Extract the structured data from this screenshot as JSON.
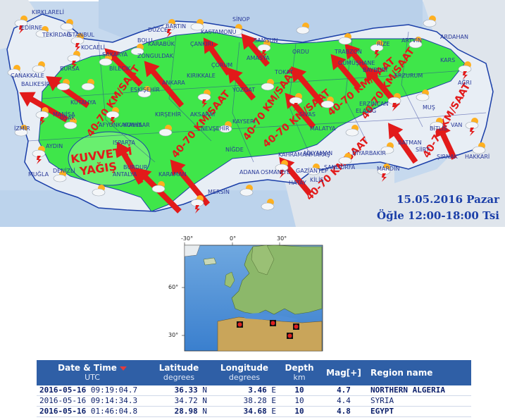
{
  "forecast": {
    "date": "15.05.2016 Pazar",
    "time": "Öğle 12:00-18:00 Tsi",
    "wind_label": "40-70 KM/SAAT",
    "rain_label_1": "KUVVETLİ",
    "rain_label_2": "YAĞIŞ",
    "colors": {
      "rain_zone": "#3fe64a",
      "land": "#e8eef5",
      "sea": "#c6d9ee",
      "arrow": "#e21a1a",
      "label_text": "#2a3a9a"
    },
    "cities": [
      "KIRKLARELİ",
      "EDİRNE",
      "TEKİRDAĞ",
      "İSTANBUL",
      "KOCAELİ",
      "ÇANAKKALE",
      "BALIKESİR",
      "BURSA",
      "SAKARYA",
      "ZONGULDAK",
      "BARTIN",
      "KASTAMONU",
      "SİNOP",
      "SAMSUN",
      "ORDU",
      "TRABZON",
      "RİZE",
      "ARTVİN",
      "ARDAHAN",
      "KARS",
      "ÇORUM",
      "YOZGAT",
      "TOKAT",
      "SİVAS",
      "GÜMÜŞHANE",
      "BAYBURT",
      "ERZURUM",
      "ERZİNCAN",
      "AĞRI",
      "VAN",
      "MUŞ",
      "BİTLİS",
      "ELAZIĞ",
      "MALATYA",
      "ANKARA",
      "KIRŞEHİR",
      "NEVŞEHİR",
      "KAYSERİ",
      "NİĞDE",
      "KONYA",
      "KARAMAN",
      "AKSARAY",
      "ESKİŞEHİR",
      "KÜTAHYA",
      "BİLECİK",
      "UŞAK",
      "AFYONKARAHİSAR",
      "MANİSA",
      "İZMİR",
      "AYDIN",
      "DENİZLİ",
      "MUĞLA",
      "BURDUR",
      "ISPARTA",
      "ANTALYA",
      "MERSİN",
      "ADANA",
      "OSMANİYE",
      "HATAY",
      "GAZİANTEP",
      "KİLİS",
      "ŞANLIURFA",
      "ADIYAMAN",
      "DİYARBAKIR",
      "MARDİN",
      "BATMAN",
      "SİİRT",
      "ŞIRNAK",
      "HAKKARİ",
      "KAHRAMANMARAŞ",
      "BOLU",
      "DÜZCE",
      "KARABÜK",
      "ÇANKIRI",
      "KIRIKKALE",
      "AMASYA"
    ]
  },
  "quake_map": {
    "lon_ticks": [
      "-30°",
      "0°",
      "30°"
    ],
    "lat_ticks": [
      "60°",
      "30°"
    ]
  },
  "quake_table": {
    "headers": {
      "datetime": "Date & Time",
      "datetime_sub": "UTC",
      "lat": "Latitude",
      "lat_sub": "degrees",
      "lon": "Longitude",
      "lon_sub": "degrees",
      "depth": "Depth",
      "depth_sub": "km",
      "mag": "Mag[+]",
      "region": "Region name"
    },
    "rows": [
      {
        "date": "2016-05-16",
        "time": "09:19:04.7",
        "lat": "36.33",
        "lat_dir": "N",
        "lon": "3.46",
        "lon_dir": "E",
        "depth": "10",
        "mag": "4.7",
        "region": "NORTHERN ALGERIA"
      },
      {
        "date": "2016-05-16",
        "time": "09:14:34.3",
        "lat": "34.72",
        "lat_dir": "N",
        "lon": "38.28",
        "lon_dir": "E",
        "depth": "10",
        "mag": "4.4",
        "region": "SYRIA"
      },
      {
        "date": "2016-05-16",
        "time": "01:46:04.8",
        "lat": "28.98",
        "lat_dir": "N",
        "lon": "34.68",
        "lon_dir": "E",
        "depth": "10",
        "mag": "4.8",
        "region": "EGYPT"
      }
    ]
  }
}
